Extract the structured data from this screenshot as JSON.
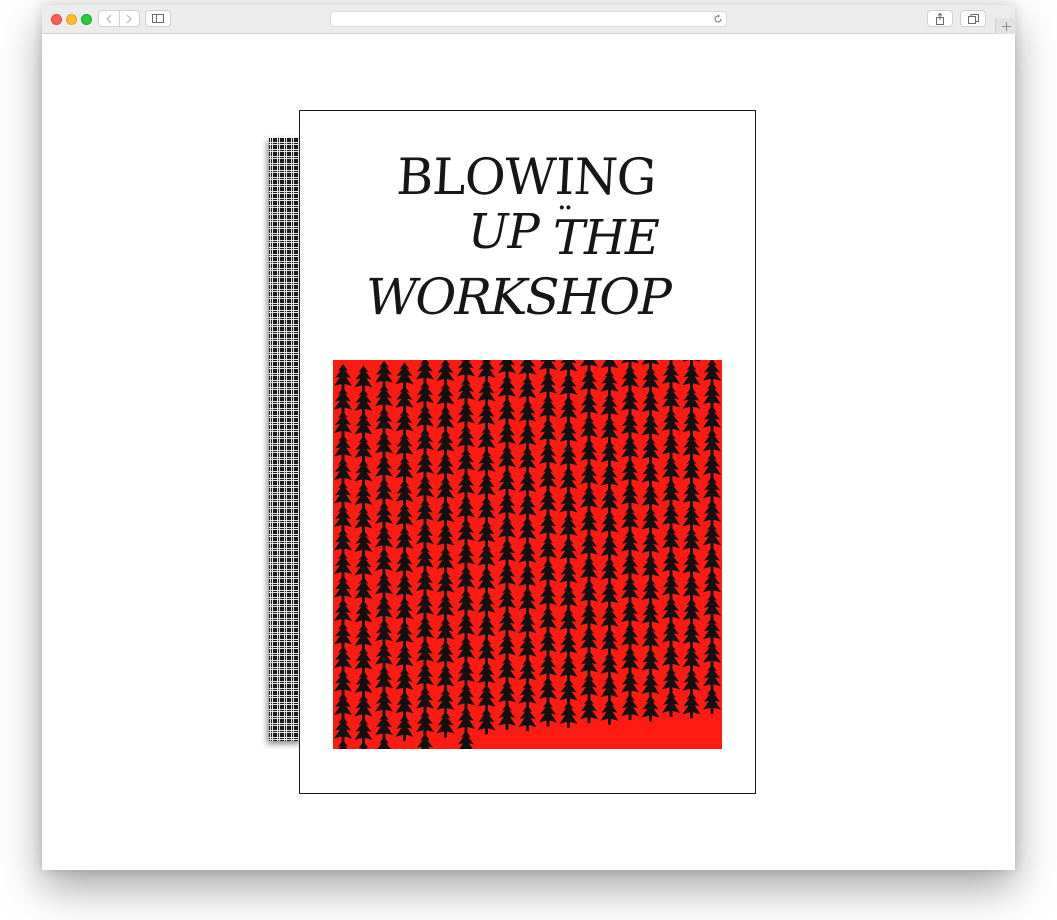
{
  "browser": {
    "url": "",
    "icons": {
      "back": "chevron-left-icon",
      "forward": "chevron-right-icon",
      "sidebar": "sidebar-icon",
      "reload": "reload-icon",
      "share": "share-icon",
      "tabs": "tabs-icon",
      "new_tab": "plus-icon"
    }
  },
  "cover": {
    "title_line1": "BLOWING",
    "title_line2a": "UP",
    "title_dots": "··",
    "title_line2b": "THE",
    "title_line3": "WORKSHOP",
    "art_background": "#ff1a12",
    "art_motif": "black-fir-tree-pattern"
  },
  "colors": {
    "cover_red": "#ff1a12",
    "ink": "#161616",
    "chrome": "#ececec"
  }
}
